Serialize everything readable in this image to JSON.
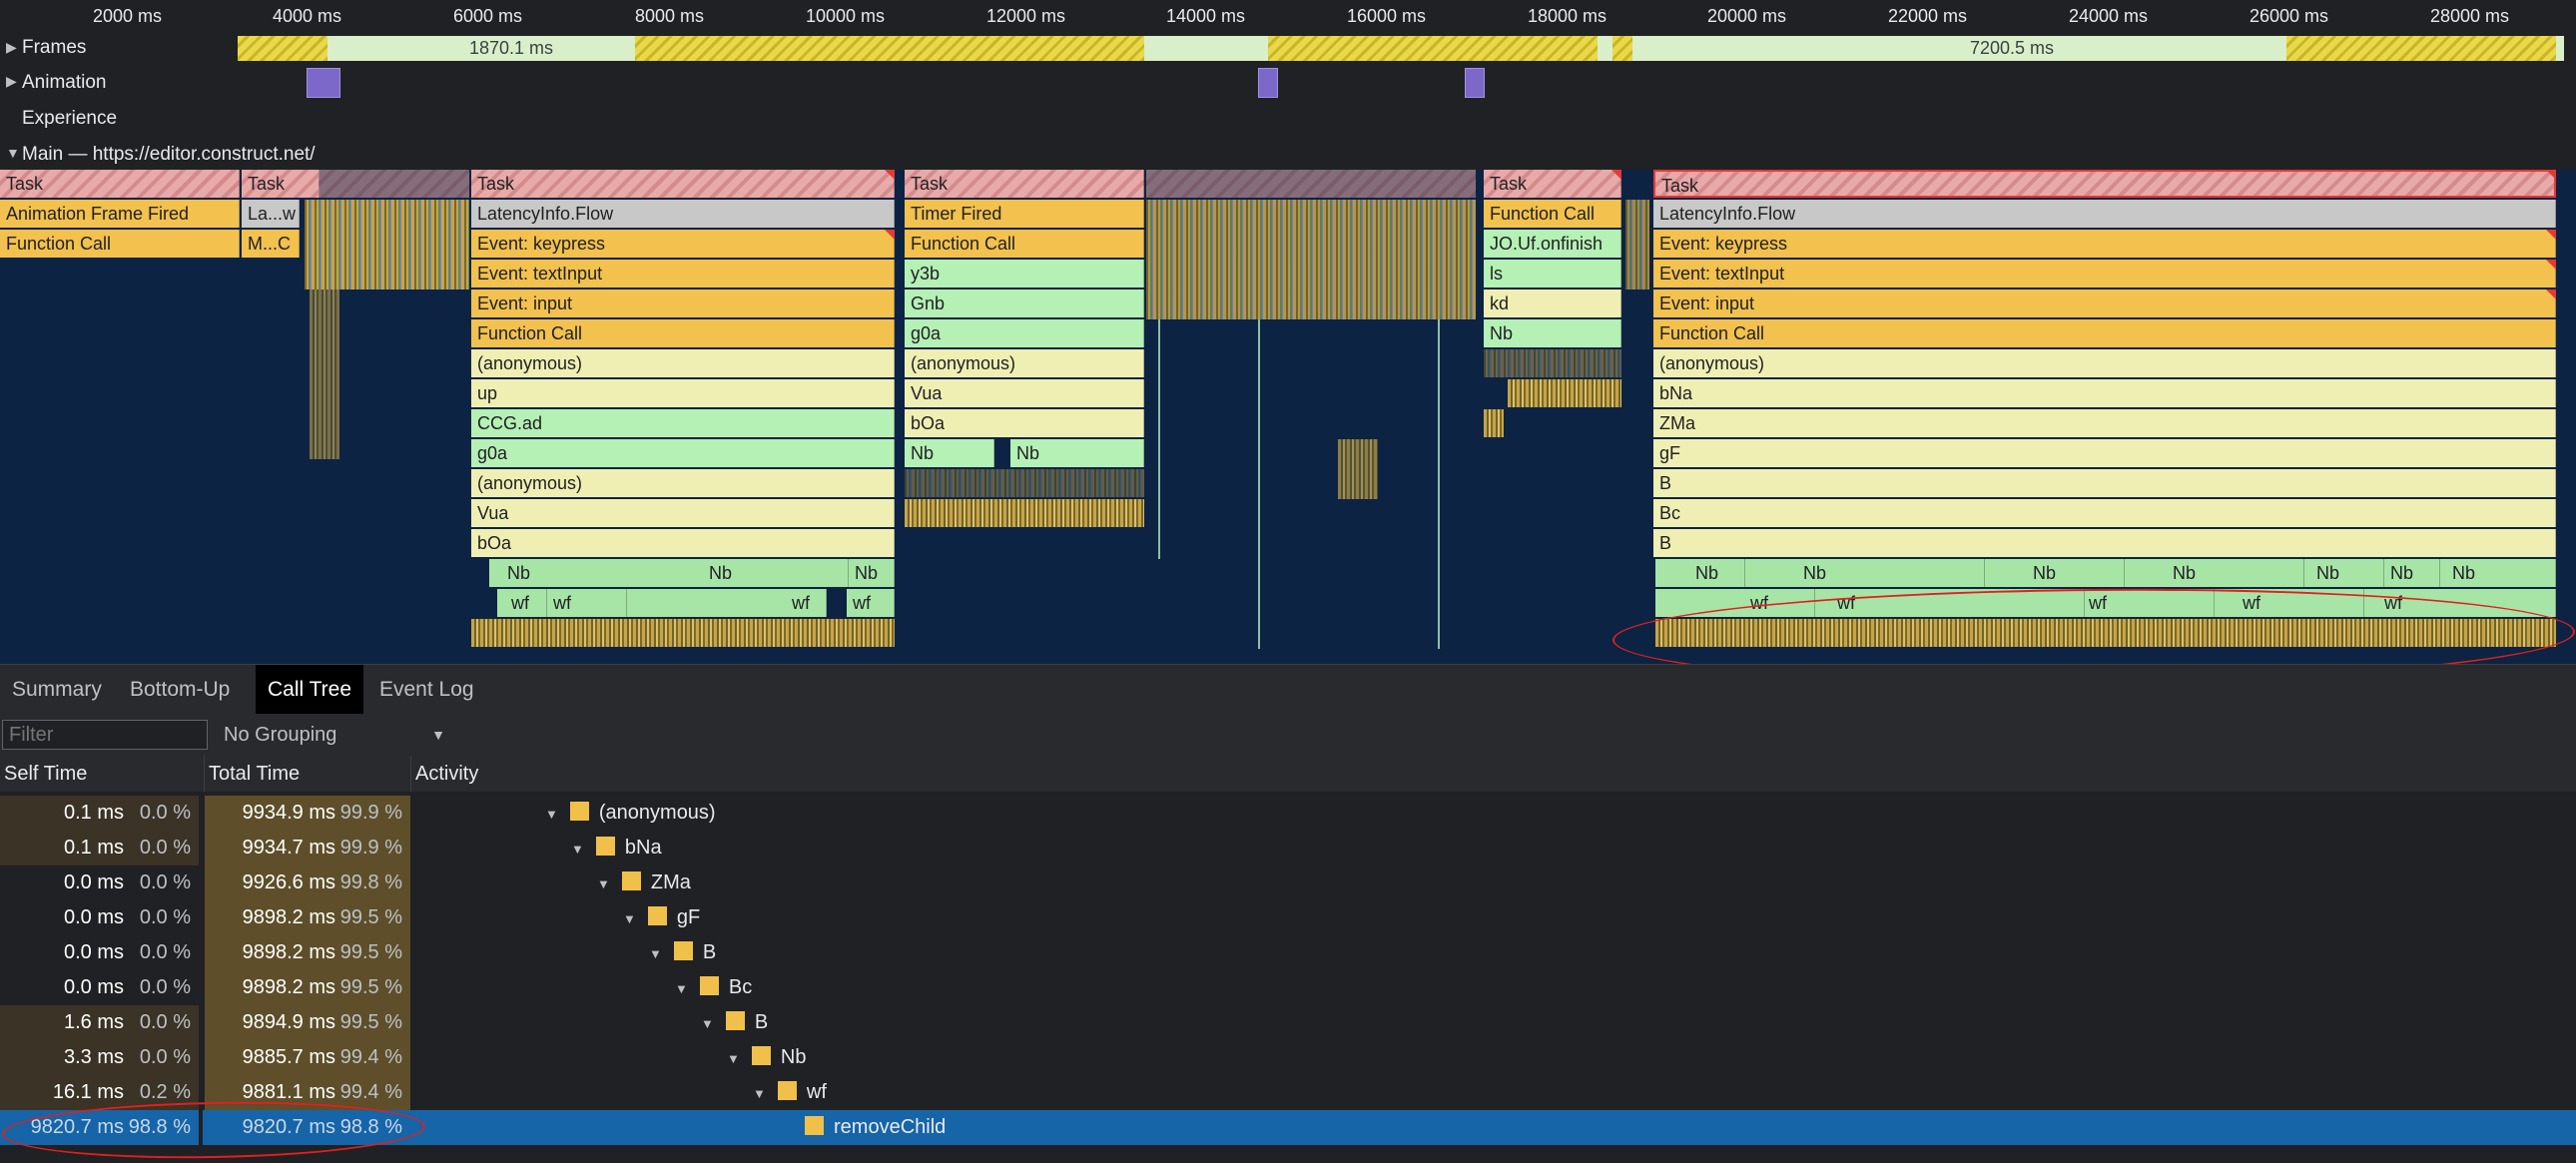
{
  "ruler": {
    "ticks": [
      "2000 ms",
      "4000 ms",
      "6000 ms",
      "8000 ms",
      "10000 ms",
      "12000 ms",
      "14000 ms",
      "16000 ms",
      "18000 ms",
      "20000 ms",
      "22000 ms",
      "24000 ms",
      "26000 ms",
      "28000 ms"
    ]
  },
  "tracks": {
    "frames": {
      "label": "Frames",
      "durations": [
        "1870.1 ms",
        "7200.5 ms"
      ]
    },
    "animation": {
      "label": "Animation"
    },
    "experience": {
      "label": "Experience"
    },
    "main": {
      "label": "Main — https://editor.construct.net/"
    }
  },
  "flame": {
    "col0": [
      "Task",
      "Animation Frame Fired",
      "Function Call"
    ],
    "col1": [
      "Task",
      "La...w",
      "M...C"
    ],
    "col2": [
      "Task",
      "LatencyInfo.Flow",
      "Event: keypress",
      "Event: textInput",
      "Event: input",
      "Function Call",
      "(anonymous)",
      "up",
      "CCG.ad",
      "g0a",
      "(anonymous)",
      "Vua",
      "bOa",
      "Nb",
      "Nb",
      "Nb",
      "wf",
      "wf",
      "wf",
      "wf"
    ],
    "col3": [
      "Task",
      "Timer Fired",
      "Function Call",
      "y3b",
      "Gnb",
      "g0a",
      "(anonymous)",
      "Vua",
      "bOa",
      "Nb",
      "Nb"
    ],
    "col4": [
      "Task",
      "Function Call",
      "JO.Uf.onfinish",
      "ls",
      "kd",
      "Nb"
    ],
    "col5": [
      "Task",
      "LatencyInfo.Flow",
      "Event: keypress",
      "Event: textInput",
      "Event: input",
      "Function Call",
      "(anonymous)",
      "bNa",
      "ZMa",
      "gF",
      "B",
      "Bc",
      "B",
      "Nb",
      "Nb",
      "Nb",
      "Nb",
      "Nb",
      "Nb",
      "Nb",
      "wf",
      "wf",
      "wf",
      "wf",
      "wf"
    ]
  },
  "tabs": [
    "Summary",
    "Bottom-Up",
    "Call Tree",
    "Event Log"
  ],
  "active_tab": "Call Tree",
  "filter": {
    "placeholder": "Filter",
    "grouping": "No Grouping"
  },
  "columns": {
    "self": "Self Time",
    "total": "Total Time",
    "activity": "Activity"
  },
  "rows": [
    {
      "self": "0.1 ms",
      "self_pct": "0.0 %",
      "total": "9934.9 ms",
      "total_pct": "99.9 %",
      "name": "(anonymous)"
    },
    {
      "self": "0.1 ms",
      "self_pct": "0.0 %",
      "total": "9934.7 ms",
      "total_pct": "99.9 %",
      "name": "bNa"
    },
    {
      "self": "0.0 ms",
      "self_pct": "0.0 %",
      "total": "9926.6 ms",
      "total_pct": "99.8 %",
      "name": "ZMa"
    },
    {
      "self": "0.0 ms",
      "self_pct": "0.0 %",
      "total": "9898.2 ms",
      "total_pct": "99.5 %",
      "name": "gF"
    },
    {
      "self": "0.0 ms",
      "self_pct": "0.0 %",
      "total": "9898.2 ms",
      "total_pct": "99.5 %",
      "name": "B"
    },
    {
      "self": "0.0 ms",
      "self_pct": "0.0 %",
      "total": "9898.2 ms",
      "total_pct": "99.5 %",
      "name": "Bc"
    },
    {
      "self": "1.6 ms",
      "self_pct": "0.0 %",
      "total": "9894.9 ms",
      "total_pct": "99.5 %",
      "name": "B"
    },
    {
      "self": "3.3 ms",
      "self_pct": "0.0 %",
      "total": "9885.7 ms",
      "total_pct": "99.4 %",
      "name": "Nb"
    },
    {
      "self": "16.1 ms",
      "self_pct": "0.2 %",
      "total": "9881.1 ms",
      "total_pct": "99.4 %",
      "name": "wf"
    },
    {
      "self": "9820.7 ms",
      "self_pct": "98.8 %",
      "total": "9820.7 ms",
      "total_pct": "98.8 %",
      "name": "removeChild"
    }
  ],
  "colors": {
    "selected_row": "#1565a8",
    "annotation": "#e02020",
    "function_call": "#f2c14e",
    "task": "#e8a9a9"
  },
  "icons": [
    "expand-triangle-icon",
    "collapse-triangle-icon",
    "function-square-icon",
    "dropdown-arrow-icon"
  ]
}
